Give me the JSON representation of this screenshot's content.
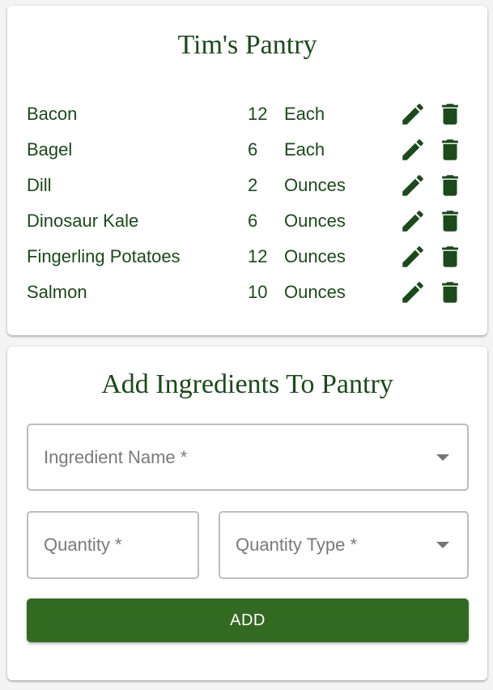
{
  "pantry": {
    "title": "Tim's Pantry",
    "items": [
      {
        "name": "Bacon",
        "quantity": "12",
        "unit": "Each"
      },
      {
        "name": "Bagel",
        "quantity": "6",
        "unit": "Each"
      },
      {
        "name": "Dill",
        "quantity": "2",
        "unit": "Ounces"
      },
      {
        "name": "Dinosaur Kale",
        "quantity": "6",
        "unit": "Ounces"
      },
      {
        "name": "Fingerling Potatoes",
        "quantity": "12",
        "unit": "Ounces"
      },
      {
        "name": "Salmon",
        "quantity": "10",
        "unit": "Ounces"
      }
    ],
    "icons": {
      "edit": "pencil-icon",
      "delete": "trash-icon"
    }
  },
  "add_form": {
    "title": "Add Ingredients To Pantry",
    "ingredient_label": "Ingredient Name *",
    "quantity_label": "Quantity *",
    "quantity_type_label": "Quantity Type *",
    "add_label": "ADD"
  },
  "colors": {
    "primary": "#336a22",
    "text": "#1b4a1b",
    "icon": "#1b4a1b"
  }
}
